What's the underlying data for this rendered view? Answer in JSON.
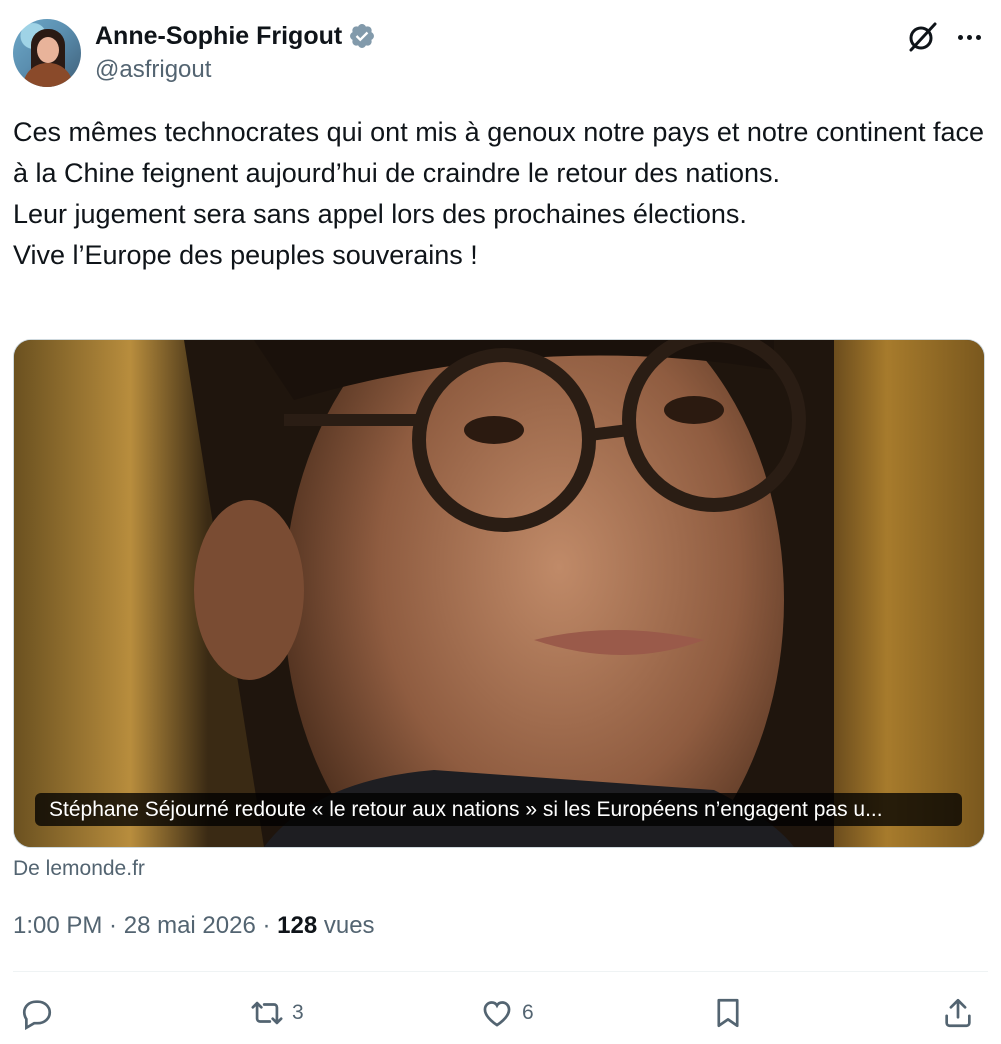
{
  "author": {
    "display_name": "Anne-Sophie Frigout",
    "handle": "@asfrigout",
    "verified": true,
    "verified_color": "#829aab"
  },
  "tweet": {
    "lines": [
      "Ces mêmes technocrates qui ont mis à genoux notre pays et notre continent face à la Chine feignent aujourd’hui de craindre le retour des nations.",
      "Leur jugement sera sans appel lors des prochaines élections.",
      "Vive l’Europe des peuples souverains !"
    ]
  },
  "card": {
    "caption": "Stéphane Séjourné redoute « le retour aux nations » si les Européens n’engagent pas u...",
    "source": "De lemonde.fr"
  },
  "meta": {
    "time": "1:00 PM",
    "separator": " · ",
    "date": "28 mai 2026",
    "views_count": "128",
    "views_label": "vues"
  },
  "actions": {
    "reply_count": "",
    "retweet_count": "3",
    "like_count": "6"
  },
  "icons": [
    "grok-icon",
    "more-icon",
    "verified-icon",
    "reply-icon",
    "retweet-icon",
    "like-icon",
    "bookmark-icon",
    "share-icon"
  ]
}
